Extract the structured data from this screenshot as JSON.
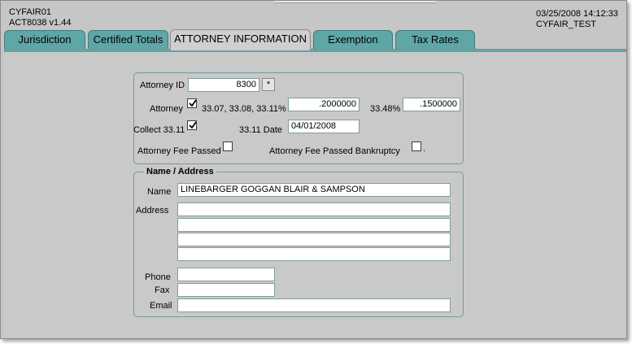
{
  "header": {
    "form_id": "CYFAIR01",
    "module": "ACT8038  v1.44",
    "datetime": "03/25/2008 14:12:33",
    "environment": "CYFAIR_TEST"
  },
  "tabs": [
    {
      "label": "Jurisdiction"
    },
    {
      "label": "Certified Totals"
    },
    {
      "label": "ATTORNEY INFORMATION",
      "active": true
    },
    {
      "label": "Exemption"
    },
    {
      "label": "Tax Rates"
    }
  ],
  "attorney": {
    "id_label": "Attorney ID",
    "id_value": "8300",
    "lookup_label": "*",
    "attorney_label": "Attorney",
    "attorney_checked": true,
    "pct1_label": "33.07, 33.08, 33.11%",
    "pct1_value": ".2000000",
    "pct2_label": "33.48%",
    "pct2_value": ".1500000",
    "collect_label": "Collect 33.11",
    "collect_checked": true,
    "date_label": "33.11 Date",
    "date_value": "04/01/2008",
    "fee_passed_label": "Attorney Fee Passed",
    "fee_passed_checked": false,
    "fee_bankruptcy_label": "Attorney Fee Passed Bankruptcy",
    "fee_bankruptcy_checked": false,
    "fee_bankruptcy_suffix": "."
  },
  "name_address": {
    "legend": "Name / Address",
    "name_label": "Name",
    "name_value": "LINEBARGER GOGGAN BLAIR & SAMPSON",
    "address_label": "Address",
    "address_lines": [
      "",
      "",
      "",
      ""
    ],
    "phone_label": "Phone",
    "phone_value": "",
    "fax_label": "Fax",
    "fax_value": "",
    "email_label": "Email",
    "email_value": ""
  },
  "colors": {
    "tab": "#5fa6a6",
    "panel": "#c9c9c9",
    "group_border": "#6f9c9c"
  }
}
